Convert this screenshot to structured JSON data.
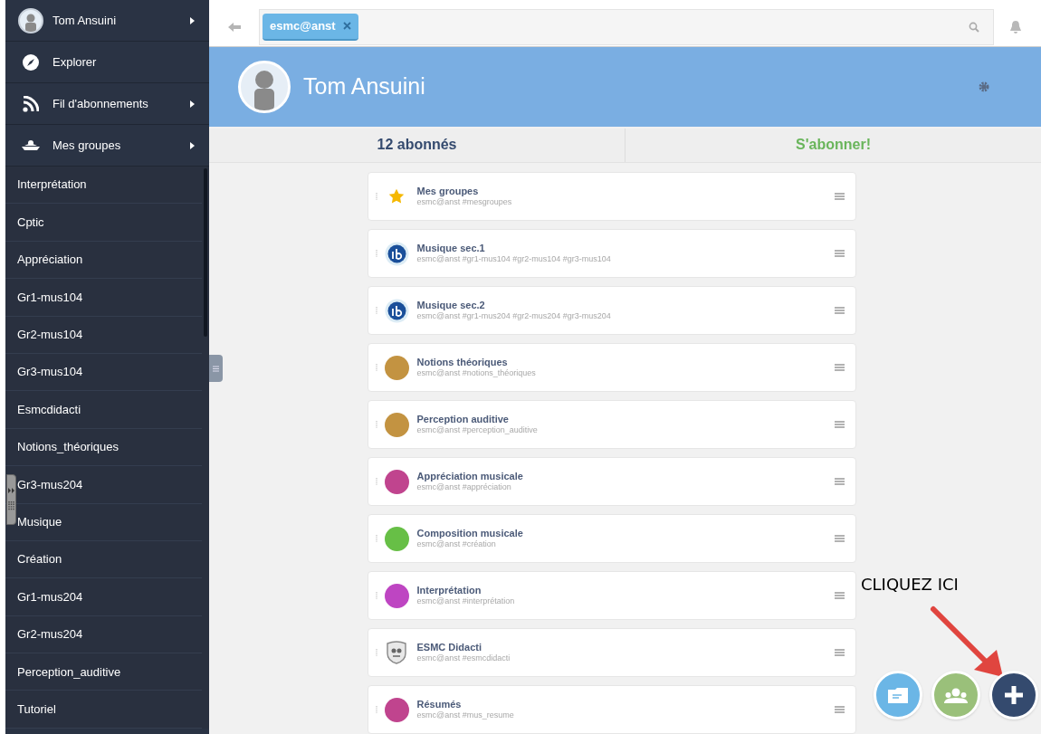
{
  "sidebar": {
    "menu": [
      {
        "kind": "avatar",
        "label": "Tom Ansuini",
        "has_submenu": true
      },
      {
        "kind": "compass",
        "label": "Explorer",
        "has_submenu": false
      },
      {
        "kind": "rss",
        "label": "Fil d'abonnements",
        "has_submenu": true
      },
      {
        "kind": "groups",
        "label": "Mes groupes",
        "has_submenu": true
      }
    ],
    "groups": [
      "Interprétation",
      "Cptic",
      "Appréciation",
      "Gr1-mus104",
      "Gr2-mus104",
      "Gr3-mus104",
      "Esmcdidacti",
      "Notions_théoriques",
      "Gr3-mus204",
      "Musique",
      "Création",
      "Gr1-mus204",
      "Gr2-mus204",
      "Perception_auditive",
      "Tutoriel"
    ]
  },
  "search": {
    "tag": "esmc@anst"
  },
  "profile": {
    "name": "Tom Ansuini"
  },
  "tabs": [
    {
      "label": "12 abonnés",
      "kind": "count"
    },
    {
      "label": "S'abonner!",
      "kind": "action"
    }
  ],
  "channels": [
    {
      "kind": "star",
      "title": "Mes groupes",
      "subtitle": "esmc@anst #mesgroupes"
    },
    {
      "kind": "ib",
      "title": "Musique sec.1",
      "subtitle": "esmc@anst #gr1-mus104 #gr2-mus104 #gr3-mus104"
    },
    {
      "kind": "ib",
      "title": "Musique sec.2",
      "subtitle": "esmc@anst #gr1-mus204 #gr2-mus204 #gr3-mus204"
    },
    {
      "kind": "dot",
      "color": "#c39341",
      "title": "Notions théoriques",
      "subtitle": "esmc@anst #notions_théoriques"
    },
    {
      "kind": "dot",
      "color": "#c39341",
      "title": "Perception auditive",
      "subtitle": "esmc@anst #perception_auditive"
    },
    {
      "kind": "dot",
      "color": "#c0448e",
      "title": "Appréciation musicale",
      "subtitle": "esmc@anst #appréciation"
    },
    {
      "kind": "dot",
      "color": "#67bf46",
      "title": "Composition musicale",
      "subtitle": "esmc@anst #création"
    },
    {
      "kind": "dot",
      "color": "#be45c2",
      "title": "Interprétation",
      "subtitle": "esmc@anst #interprétation"
    },
    {
      "kind": "crest",
      "title": "ESMC Didacti",
      "subtitle": "esmc@anst #esmcdidacti"
    },
    {
      "kind": "dot",
      "color": "#c0448e",
      "title": "Résumés",
      "subtitle": "esmc@anst #mus_resume"
    }
  ],
  "annotation": {
    "text": "CLIQUEZ ICI"
  }
}
